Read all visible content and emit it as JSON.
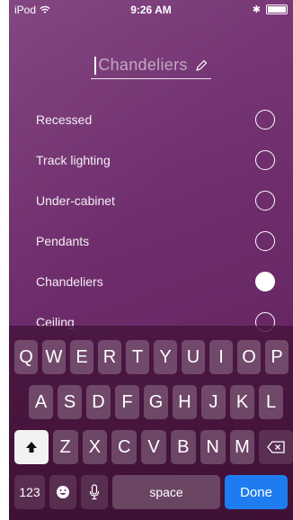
{
  "status": {
    "carrier": "iPod",
    "time": "9:26 AM"
  },
  "title": {
    "text": "Chandeliers"
  },
  "list": [
    {
      "label": "Recessed",
      "selected": false
    },
    {
      "label": "Track lighting",
      "selected": false
    },
    {
      "label": "Under-cabinet",
      "selected": false
    },
    {
      "label": "Pendants",
      "selected": false
    },
    {
      "label": "Chandeliers",
      "selected": true
    },
    {
      "label": "Ceiling",
      "selected": false
    }
  ],
  "keyboard": {
    "row1": [
      "Q",
      "W",
      "E",
      "R",
      "T",
      "Y",
      "U",
      "I",
      "O",
      "P"
    ],
    "row2": [
      "A",
      "S",
      "D",
      "F",
      "G",
      "H",
      "J",
      "K",
      "L"
    ],
    "row3": [
      "Z",
      "X",
      "C",
      "V",
      "B",
      "N",
      "M"
    ],
    "numbers_label": "123",
    "space_label": "space",
    "done_label": "Done"
  }
}
